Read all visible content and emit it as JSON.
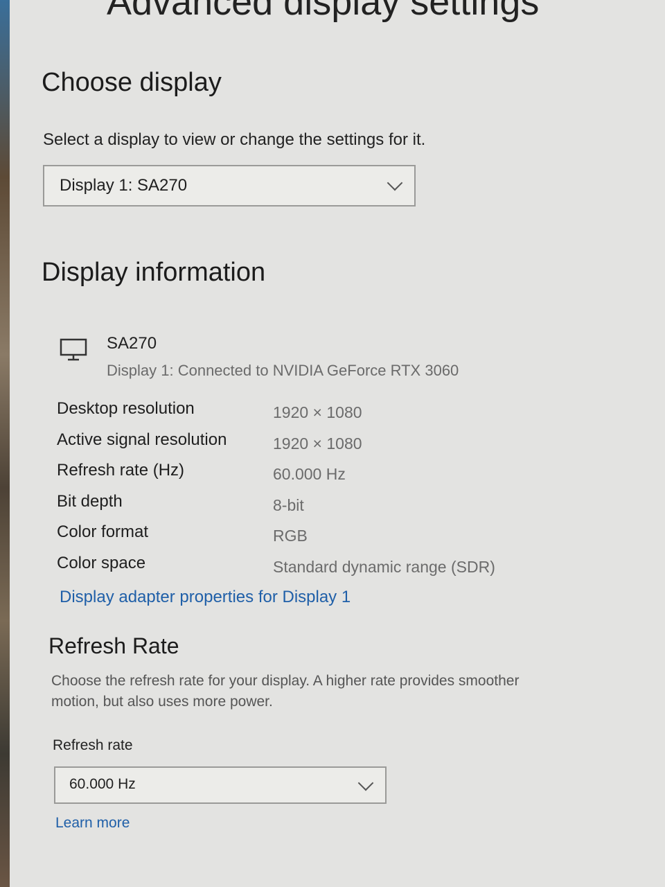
{
  "header": {
    "title": "Advanced display settings"
  },
  "choose_display": {
    "heading": "Choose display",
    "description": "Select a display to view or change the settings for it.",
    "selected_display": "Display 1: SA270"
  },
  "display_information": {
    "heading": "Display information",
    "monitor_icon": "monitor-icon",
    "monitor_name": "SA270",
    "monitor_subtitle": "Display 1: Connected to NVIDIA GeForce RTX 3060",
    "rows": [
      {
        "label": "Desktop resolution",
        "value": "1920 × 1080"
      },
      {
        "label": "Active signal resolution",
        "value": "1920 × 1080"
      },
      {
        "label": "Refresh rate (Hz)",
        "value": "60.000 Hz"
      },
      {
        "label": "Bit depth",
        "value": "8-bit"
      },
      {
        "label": "Color format",
        "value": "RGB"
      },
      {
        "label": "Color space",
        "value": "Standard dynamic range (SDR)"
      }
    ],
    "adapter_link": "Display adapter properties for Display 1"
  },
  "refresh_rate": {
    "heading": "Refresh Rate",
    "description": "Choose the refresh rate for your display. A higher rate provides smoother motion, but also uses more power.",
    "field_label": "Refresh rate",
    "selected_value": "60.000 Hz",
    "learn_more": "Learn more"
  },
  "colors": {
    "link": "#1f5fa8",
    "background": "#e3e3e1"
  }
}
